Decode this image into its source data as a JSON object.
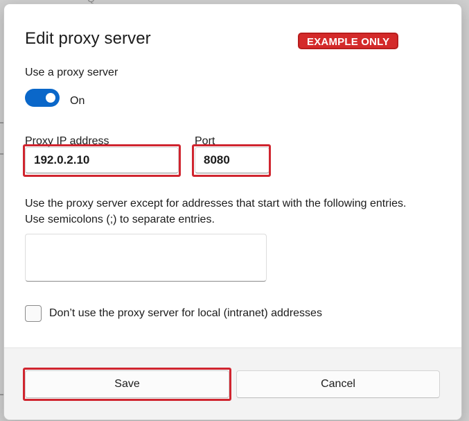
{
  "dialog": {
    "title": "Edit proxy server",
    "watermark_badge": "EXAMPLE ONLY",
    "use_proxy_label": "Use a proxy server",
    "toggle_state": "On",
    "proxy_ip": {
      "label": "Proxy IP address",
      "value": "192.0.2.10"
    },
    "port": {
      "label": "Port",
      "value": "8080"
    },
    "exceptions": {
      "description_line1": "Use the proxy server except for addresses that start with the following entries.",
      "description_line2": "Use semicolons (;) to separate entries.",
      "value": ""
    },
    "local_bypass_label": "Don’t use the proxy server for local (intranet) addresses",
    "save_label": "Save",
    "cancel_label": "Cancel"
  },
  "backdrop": {
    "partial_glyph": "Q"
  },
  "colors": {
    "accent": "#0a67c9",
    "highlight_red": "#d0252f",
    "badge_red": "#d42a2a"
  }
}
